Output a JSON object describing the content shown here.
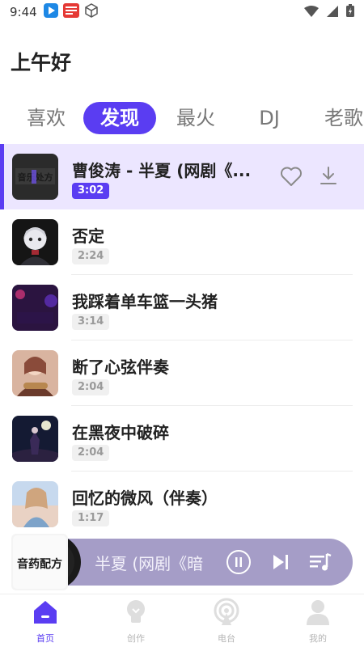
{
  "status_bar": {
    "time": "9:44",
    "app_icons": [
      "player-app-icon",
      "news-app-icon",
      "cube-app-icon"
    ],
    "right_icons": [
      "wifi-icon",
      "signal-icon",
      "battery-icon"
    ]
  },
  "greeting": "上午好",
  "tabs": [
    {
      "label": "喜欢",
      "active": false
    },
    {
      "label": "发现",
      "active": true
    },
    {
      "label": "最火",
      "active": false
    },
    {
      "label": "DJ",
      "active": false
    },
    {
      "label": "老歌",
      "active": false
    }
  ],
  "songs": [
    {
      "title": "曹俊涛 - 半夏 (网剧《...",
      "duration": "3:02",
      "playing": true,
      "cover_text": "音乐处方"
    },
    {
      "title": "否定",
      "duration": "2:24",
      "playing": false
    },
    {
      "title": "我踩着单车篮一头猪",
      "duration": "3:14",
      "playing": false
    },
    {
      "title": "断了心弦伴奏",
      "duration": "2:04",
      "playing": false
    },
    {
      "title": "在黑夜中破碎",
      "duration": "2:04",
      "playing": false
    },
    {
      "title": "回忆的微风（伴奏）",
      "duration": "1:17",
      "playing": false
    }
  ],
  "mini_player": {
    "scrolling_title": "半夏 (网剧《暗",
    "cover_text": "音药配方"
  },
  "bottom_nav": [
    {
      "label": "首页",
      "icon": "home-icon",
      "active": true
    },
    {
      "label": "创作",
      "icon": "lightbulb-icon",
      "active": false
    },
    {
      "label": "电台",
      "icon": "radio-icon",
      "active": false
    },
    {
      "label": "我的",
      "icon": "person-icon",
      "active": false
    }
  ],
  "colors": {
    "accent": "#5a3df2",
    "playing_row_bg": "#ece6ff",
    "mini_player_bg": "#a59dc7"
  }
}
